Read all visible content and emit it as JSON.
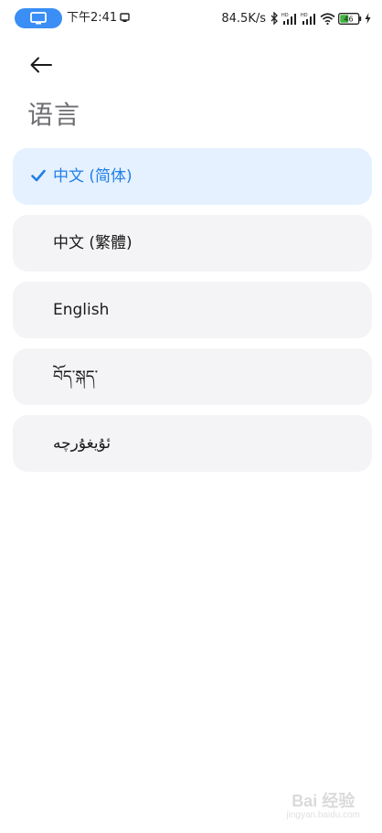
{
  "status_bar": {
    "time": "下午2:41",
    "net_speed": "84.5K/s",
    "battery": "46",
    "icons": [
      "screen-cast-icon",
      "message-icon",
      "bluetooth-icon",
      "signal-hd-icon",
      "signal-hd-icon",
      "wifi-icon",
      "battery-icon",
      "charging-icon"
    ]
  },
  "header": {
    "back_icon": "arrow-left-icon",
    "title": "语言"
  },
  "languages": [
    {
      "label": "中文 (简体)",
      "selected": true
    },
    {
      "label": "中文 (繁體)",
      "selected": false
    },
    {
      "label": "English",
      "selected": false
    },
    {
      "label": "བོད་སྐད་",
      "selected": false
    },
    {
      "label": "ئۇيغۇرچە",
      "selected": false
    }
  ],
  "colors": {
    "accent": "#1f7fe8",
    "selected_bg": "#e5f1fe",
    "item_bg": "#f4f4f6",
    "title": "#6d6d72"
  },
  "watermark": {
    "text": "Bai 经验",
    "sub": "jingyan.baidu.com"
  }
}
